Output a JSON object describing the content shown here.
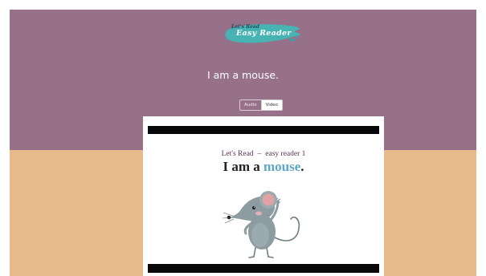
{
  "logo": {
    "line1": "Let's Read",
    "line2": "Easy Reader"
  },
  "book": {
    "title": "I am a mouse."
  },
  "media_toggle": {
    "audio_label": "Audio",
    "video_label": "Video",
    "selected": "Video"
  },
  "video": {
    "caption_left": "Let's Read",
    "caption_separator": "–",
    "caption_right": "easy reader 1",
    "sentence_prefix": "I am a ",
    "sentence_highlight": "mouse",
    "sentence_suffix": "."
  },
  "colors": {
    "header_band": "#97708a",
    "lower_band": "#e8b98a",
    "highlight_word": "#5fa7c6",
    "caption_text": "#5b2f57",
    "logo_brush": "#47b3b3"
  },
  "icons": {
    "mouse_illustration": "mouse-illustration"
  }
}
